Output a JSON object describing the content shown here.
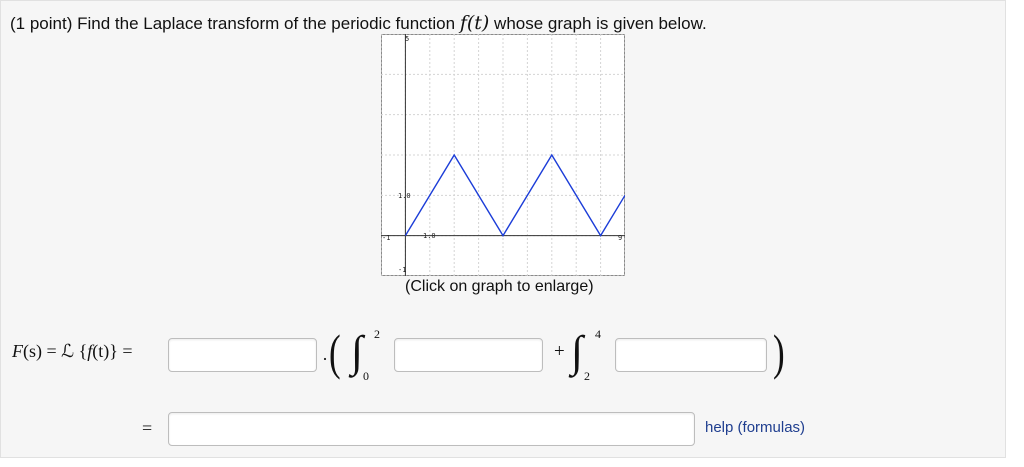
{
  "problem": {
    "points": "(1 point)",
    "text_before": " Find the Laplace transform of the periodic function ",
    "func": "f(t)",
    "text_after": " whose graph is given below."
  },
  "graph": {
    "caption": "(Click on graph to enlarge)",
    "labels": {
      "y_top": "5",
      "y_one": "1.0",
      "x_one": "1.0",
      "x_left": "-1",
      "x_right": "9",
      "y_bottom": "-1"
    }
  },
  "chart_data": {
    "type": "line",
    "xlim": [
      -1,
      9
    ],
    "ylim": [
      -1,
      5
    ],
    "grid": true,
    "series": [
      {
        "x": [
          0,
          2,
          4,
          6,
          8,
          9
        ],
        "y": [
          0,
          2,
          0,
          2,
          0,
          1
        ]
      }
    ]
  },
  "formula": {
    "lhs_F": "F",
    "lhs_s": "(s)",
    "eq1": " = ",
    "L": "ℒ",
    "brace_open": " {",
    "f": "f",
    "t": "(t)",
    "brace_close": "}",
    "eq2": " =",
    "dot": "·",
    "paren_open": "(",
    "paren_close": ")",
    "int1_upper": "2",
    "int1_lower": "0",
    "int2_upper": "4",
    "int2_lower": "2",
    "plus": "+",
    "eq_row2": "="
  },
  "inputs": {
    "factor_value": "",
    "integrand1_value": "",
    "integrand2_value": "",
    "result_value": ""
  },
  "help": {
    "label": "help (formulas)"
  }
}
